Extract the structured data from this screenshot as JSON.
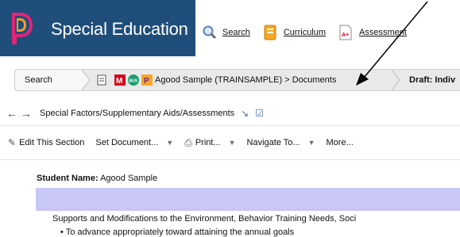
{
  "header": {
    "app_title": "Special Education",
    "links": [
      {
        "label": "Search",
        "icon": "search-icon"
      },
      {
        "label": "Curriculum",
        "icon": "curriculum-icon"
      },
      {
        "label": "Assessment",
        "icon": "assessment-icon"
      }
    ]
  },
  "breadcrumb": {
    "search_label": "Search",
    "docs_label": "Agood Sample (TRAINSAMPLE) > Documents",
    "draft_label": "Draft: Indiv"
  },
  "navbar": {
    "section_name": "Special Factors/Supplementary Aids/Assessments"
  },
  "toolbar": {
    "edit_label": "Edit This Section",
    "set_document_label": "Set Document...",
    "print_label": "Print...",
    "navigate_label": "Navigate To...",
    "more_label": "More..."
  },
  "content": {
    "student_label": "Student Name:",
    "student_value": " Agood Sample",
    "supports_text": "Supports and Modifications to the Environment, Behavior Training Needs, Soci",
    "bullet_text": "•  To advance appropriately toward attaining the annual goals"
  },
  "colors": {
    "banner": "#1f4e7a",
    "highlight_band": "#c9c7f5"
  }
}
